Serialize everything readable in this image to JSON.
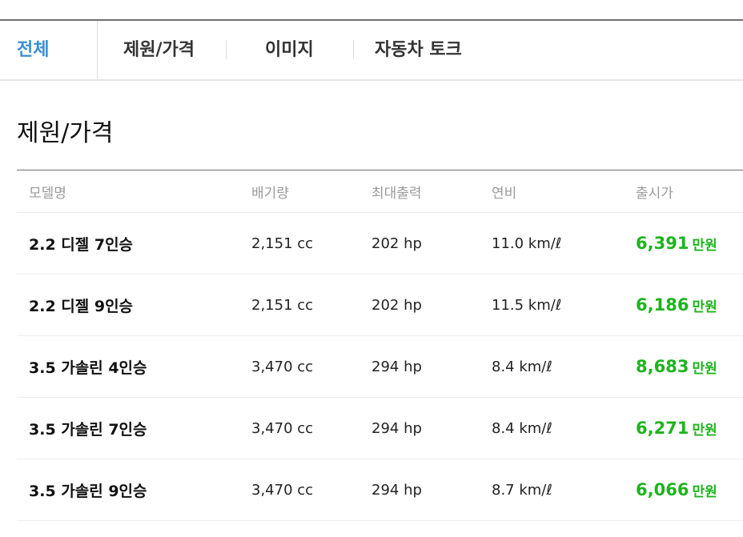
{
  "tabs": [
    {
      "label": "전체",
      "active": true
    },
    {
      "label": "제원/가격",
      "active": false
    },
    {
      "label": "이미지",
      "active": false
    },
    {
      "label": "자동차 토크",
      "active": false
    }
  ],
  "section": {
    "title": "제원/가격"
  },
  "table": {
    "headers": {
      "model": "모델명",
      "displacement": "배기량",
      "power": "최대출력",
      "fuel": "연비",
      "price": "출시가"
    },
    "rows": [
      {
        "model": "2.2 디젤 7인승",
        "displacement": "2,151 cc",
        "power": "202 hp",
        "fuel": "11.0 km/ℓ",
        "price": "6,391",
        "unit": "만원"
      },
      {
        "model": "2.2 디젤 9인승",
        "displacement": "2,151 cc",
        "power": "202 hp",
        "fuel": "11.5 km/ℓ",
        "price": "6,186",
        "unit": "만원"
      },
      {
        "model": "3.5 가솔린 4인승",
        "displacement": "3,470 cc",
        "power": "294 hp",
        "fuel": "8.4 km/ℓ",
        "price": "8,683",
        "unit": "만원"
      },
      {
        "model": "3.5 가솔린 7인승",
        "displacement": "3,470 cc",
        "power": "294 hp",
        "fuel": "8.4 km/ℓ",
        "price": "6,271",
        "unit": "만원"
      },
      {
        "model": "3.5 가솔린 9인승",
        "displacement": "3,470 cc",
        "power": "294 hp",
        "fuel": "8.7 km/ℓ",
        "price": "6,066",
        "unit": "만원"
      }
    ]
  },
  "colors": {
    "active_tab": "#3a8fd6",
    "price": "#1fb31f"
  }
}
